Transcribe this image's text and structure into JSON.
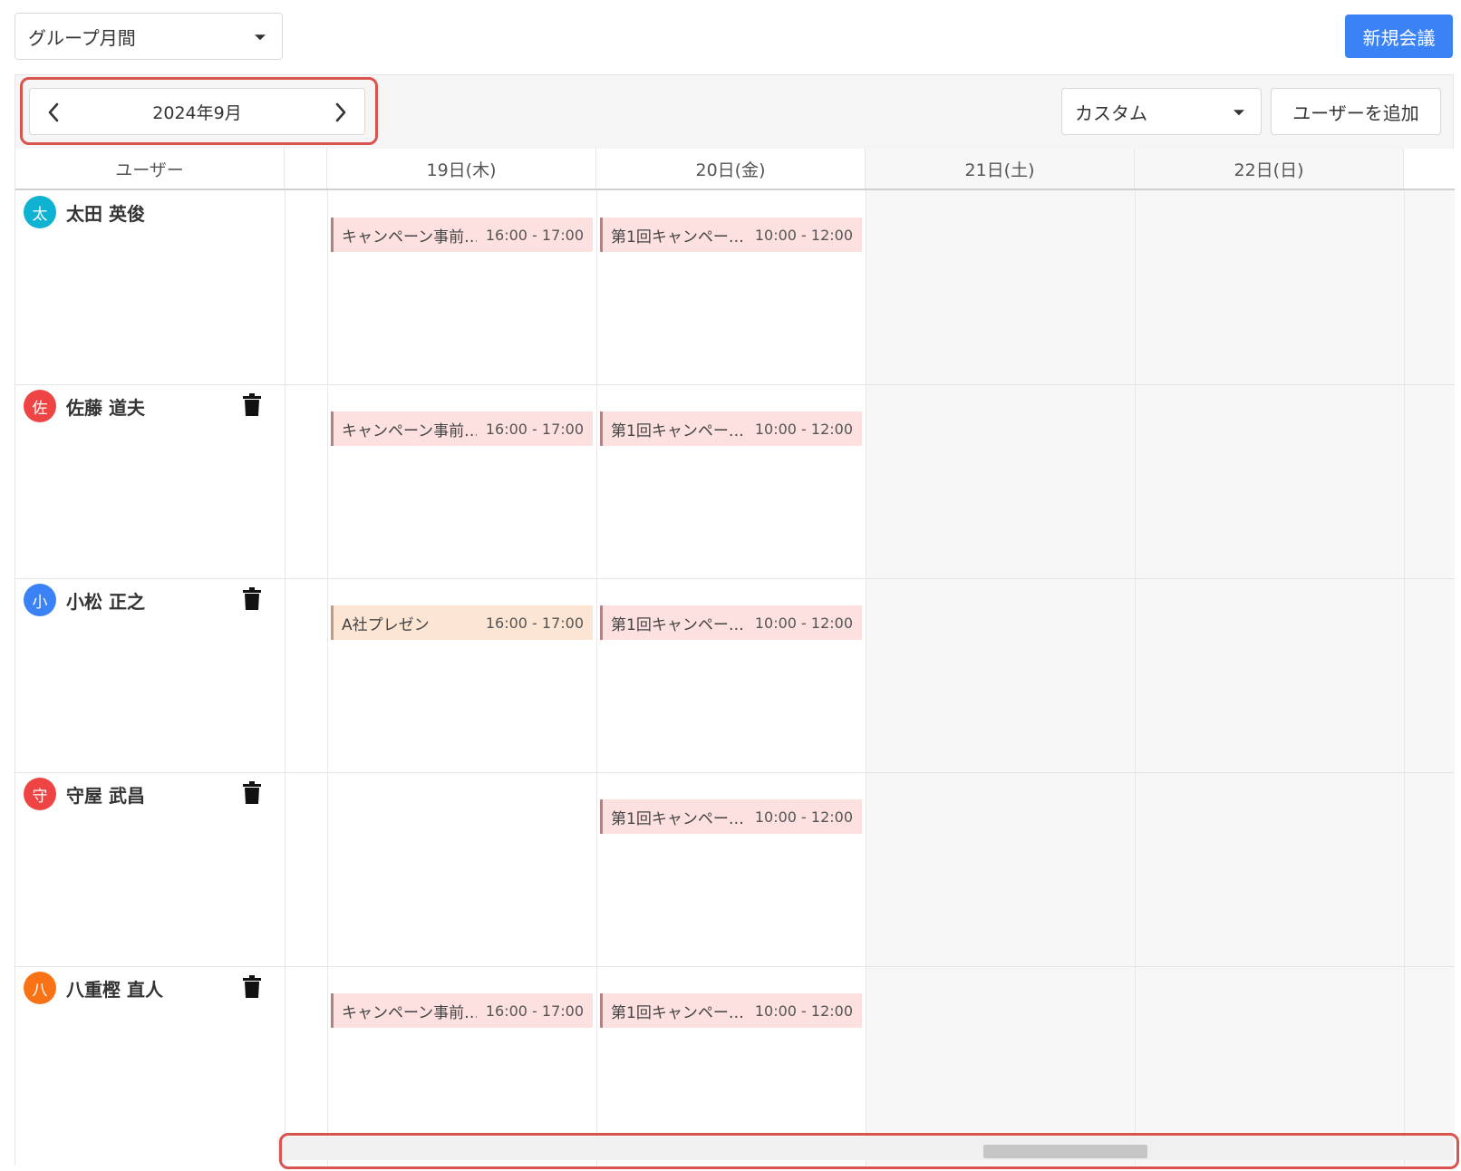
{
  "header": {
    "view_selector": "グループ月間",
    "new_meeting_label": "新規会議"
  },
  "toolbar": {
    "month_label": "2024年9月",
    "range_selector": "カスタム",
    "add_user_label": "ユーザーを追加"
  },
  "columns": {
    "user_header": "ユーザー",
    "days": [
      "19日(木)",
      "20日(金)",
      "21日(土)",
      "22日(日)"
    ]
  },
  "users": [
    {
      "avatar": "太",
      "avatar_color": "#0fb3d1",
      "name": "太田 英俊",
      "deletable": false,
      "events": [
        {
          "day": 0,
          "title": "キャンペーン事前…",
          "time": "16:00 - 17:00",
          "color": "pink"
        },
        {
          "day": 1,
          "title": "第1回キャンペー…",
          "time": "10:00 - 12:00",
          "color": "pink"
        }
      ]
    },
    {
      "avatar": "佐",
      "avatar_color": "#ef4444",
      "name": "佐藤 道夫",
      "deletable": true,
      "events": [
        {
          "day": 0,
          "title": "キャンペーン事前…",
          "time": "16:00 - 17:00",
          "color": "pink"
        },
        {
          "day": 1,
          "title": "第1回キャンペー…",
          "time": "10:00 - 12:00",
          "color": "pink"
        }
      ]
    },
    {
      "avatar": "小",
      "avatar_color": "#3b82f6",
      "name": "小松 正之",
      "deletable": true,
      "events": [
        {
          "day": 0,
          "title": "A社プレゼン",
          "time": "16:00 - 17:00",
          "color": "orange"
        },
        {
          "day": 1,
          "title": "第1回キャンペー…",
          "time": "10:00 - 12:00",
          "color": "pink"
        }
      ]
    },
    {
      "avatar": "守",
      "avatar_color": "#ef4444",
      "name": "守屋 武昌",
      "deletable": true,
      "events": [
        {
          "day": 1,
          "title": "第1回キャンペー…",
          "time": "10:00 - 12:00",
          "color": "pink"
        }
      ]
    },
    {
      "avatar": "八",
      "avatar_color": "#f97316",
      "name": "八重樫 直人",
      "deletable": true,
      "events": [
        {
          "day": 0,
          "title": "キャンペーン事前…",
          "time": "16:00 - 17:00",
          "color": "pink"
        },
        {
          "day": 1,
          "title": "第1回キャンペー…",
          "time": "10:00 - 12:00",
          "color": "pink"
        }
      ]
    }
  ]
}
